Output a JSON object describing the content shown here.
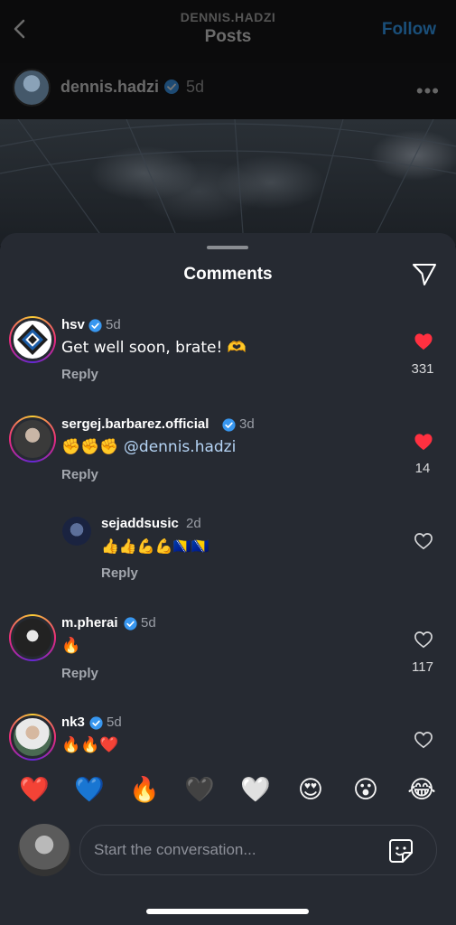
{
  "header": {
    "subtitle": "DENNIS.HADZI",
    "title": "Posts",
    "follow_label": "Follow"
  },
  "post": {
    "username": "dennis.hadzi",
    "time": "5d"
  },
  "sheet": {
    "title": "Comments"
  },
  "comments": [
    {
      "username": "hsv",
      "time": "5d",
      "text": "Get well soon, brate! 🫶",
      "reply_label": "Reply",
      "likes": "331",
      "liked": true,
      "verified": true
    },
    {
      "username": "sergej.barbarez.official",
      "time": "3d",
      "text_prefix": "✊✊✊ ",
      "mention": "@dennis.hadzi",
      "reply_label": "Reply",
      "likes": "14",
      "liked": true,
      "verified": true
    },
    {
      "username": "sejaddsusic",
      "time": "2d",
      "text": "👍👍💪💪🇧🇦🇧🇦",
      "reply_label": "Reply",
      "likes": "",
      "liked": false,
      "verified": false
    },
    {
      "username": "m.pherai",
      "time": "5d",
      "text": "🔥",
      "reply_label": "Reply",
      "likes": "117",
      "liked": false,
      "verified": true
    },
    {
      "username": "nk3",
      "time": "5d",
      "text": "🔥🔥❤️",
      "reply_label": "",
      "likes": "",
      "liked": false,
      "verified": true
    }
  ],
  "reactions": [
    "❤️",
    "💙",
    "🔥",
    "🖤",
    "🤍",
    "😍",
    "😮",
    "😂"
  ],
  "composer": {
    "placeholder": "Start the conversation..."
  },
  "colors": {
    "sheet_bg": "#262a32",
    "like_red": "#ff3040",
    "verified_blue": "#3897f0",
    "mention_blue": "#b5d4f5"
  }
}
